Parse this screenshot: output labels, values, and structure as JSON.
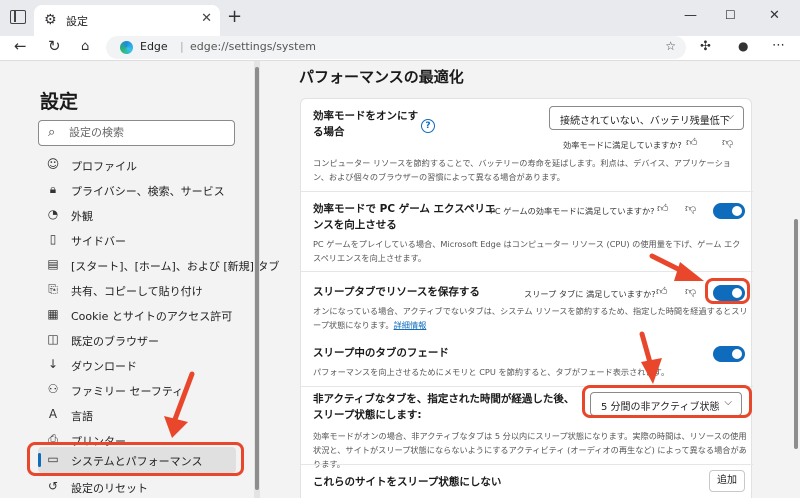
{
  "browser": {
    "tab_title": "設定",
    "omnibox_label": "Edge",
    "omnibox_separator": "|",
    "url": "edge://settings/system"
  },
  "sidebar": {
    "title": "設定",
    "search_placeholder": "設定の検索",
    "items": [
      {
        "label": "プロファイル",
        "icon": "profile-icon"
      },
      {
        "label": "プライバシー、検索、サービス",
        "icon": "lock-icon"
      },
      {
        "label": "外観",
        "icon": "appearance-icon"
      },
      {
        "label": "サイドバー",
        "icon": "sidebar-icon"
      },
      {
        "label": "[スタート]、[ホーム]、および [新規] タブ",
        "icon": "home-tab-icon"
      },
      {
        "label": "共有、コピーして貼り付け",
        "icon": "share-icon"
      },
      {
        "label": "Cookie とサイトのアクセス許可",
        "icon": "cookie-icon"
      },
      {
        "label": "既定のブラウザー",
        "icon": "browser-icon"
      },
      {
        "label": "ダウンロード",
        "icon": "download-icon"
      },
      {
        "label": "ファミリー セーフティ",
        "icon": "family-icon"
      },
      {
        "label": "言語",
        "icon": "language-icon"
      },
      {
        "label": "プリンター",
        "icon": "printer-icon"
      },
      {
        "label": "システムとパフォーマンス",
        "icon": "laptop-icon"
      },
      {
        "label": "設定のリセット",
        "icon": "reset-icon"
      }
    ]
  },
  "main": {
    "title": "パフォーマンスの最適化",
    "efficiency": {
      "title": "効率モードをオンにする場合",
      "select_value": "接続されていない、バッテリ残量低下",
      "feedback": "効率モードに満足していますか?",
      "desc": "コンピューター リソースを節約することで、バッテリーの寿命を延ばします。利点は、デバイス、アプリケーション、および個々のブラウザーの習慣によって異なる場合があります。"
    },
    "pc_game": {
      "title": "効率モードで PC ゲーム エクスペリエンスを向上させる",
      "feedback": "PC ゲームの効率モードに満足していますか?",
      "desc": "PC ゲームをプレイしている場合、Microsoft Edge はコンピューター リソース (CPU) の使用量を下げ、ゲーム エクスペリエンスを向上させます。"
    },
    "sleeping_tabs": {
      "title": "スリープタブでリソースを保存する",
      "feedback": "スリープ タブに 満足していますか?",
      "desc": "オンになっている場合、アクティブでないタブは、システム リソースを節約するため、指定した時間を経過するとスリープ状態になります。",
      "link": "詳細情報"
    },
    "fade": {
      "title": "スリープ中のタブのフェード",
      "desc": "パフォーマンスを向上させるためにメモリと CPU を節約すると、タブがフェード表示されます。"
    },
    "inactive": {
      "title": "非アクティブなタブを、指定された時間が経過した後、スリープ状態にします:",
      "select_value": "5 分間の非アクティブ状態",
      "desc": "効率モードがオンの場合、非アクティブなタブは 5 分以内にスリープ状態になります。実際の時間は、リソースの使用状況と、サイトがスリープ状態にならないようにするアクティビティ (オーディオの再生など) によって異なる場合があります。"
    },
    "never_sleep": {
      "title": "これらのサイトをスリープ状態にしない",
      "add_label": "追加"
    }
  },
  "colors": {
    "accent": "#0f6cbd",
    "annotation": "#e8472c"
  }
}
